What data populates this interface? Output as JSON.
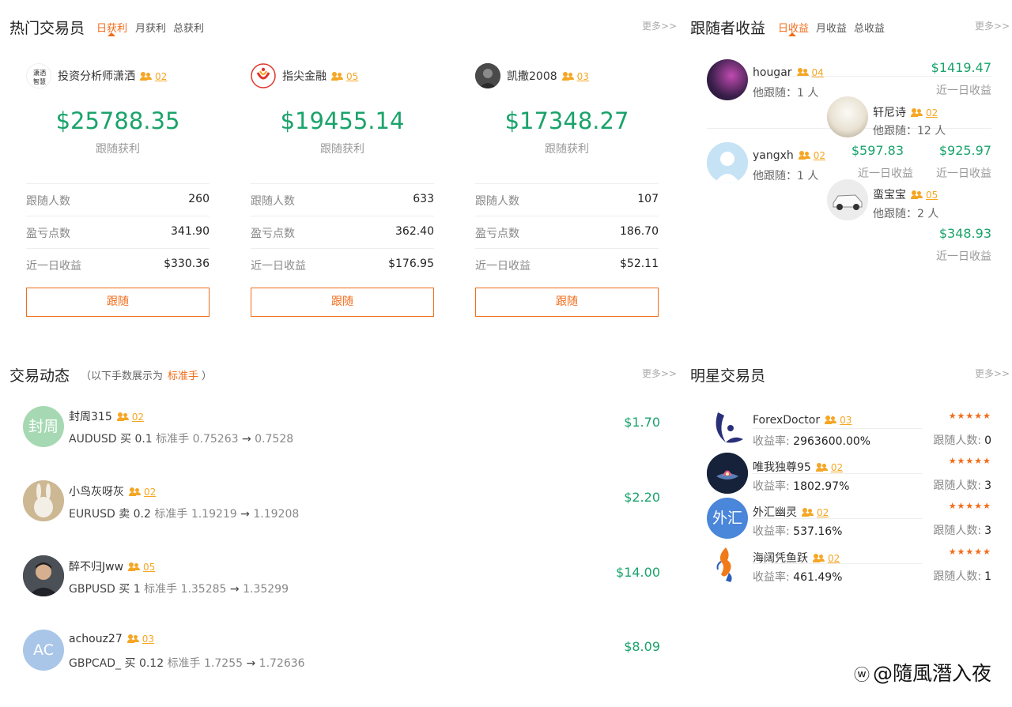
{
  "hot_traders": {
    "title": "热门交易员",
    "tabs": [
      "日获利",
      "月获利",
      "总获利"
    ],
    "more": "更多>>",
    "cards": [
      {
        "name": "投资分析师潇洒",
        "followers_badge": "02",
        "profit": "$25788.35",
        "profit_label": "跟随获利",
        "rows": [
          {
            "k": "跟随人数",
            "v": "260"
          },
          {
            "k": "盈亏点数",
            "v": "341.90"
          },
          {
            "k": "近一日收益",
            "v": "$330.36"
          }
        ],
        "button": "跟随"
      },
      {
        "name": "指尖金融",
        "followers_badge": "05",
        "profit": "$19455.14",
        "profit_label": "跟随获利",
        "rows": [
          {
            "k": "跟随人数",
            "v": "633"
          },
          {
            "k": "盈亏点数",
            "v": "362.40"
          },
          {
            "k": "近一日收益",
            "v": "$176.95"
          }
        ],
        "button": "跟随"
      },
      {
        "name": "凯撒2008",
        "followers_badge": "03",
        "profit": "$17348.27",
        "profit_label": "跟随获利",
        "rows": [
          {
            "k": "跟随人数",
            "v": "107"
          },
          {
            "k": "盈亏点数",
            "v": "186.70"
          },
          {
            "k": "近一日收益",
            "v": "$52.11"
          }
        ],
        "button": "跟随"
      }
    ],
    "logo_text": "潇洒智慧"
  },
  "follower_earnings": {
    "title": "跟随者收益",
    "tabs": [
      "日收益",
      "月收益",
      "总收益"
    ],
    "more": "更多>>",
    "entries": [
      {
        "name": "hougar",
        "badge": "04",
        "sub": "他跟随：1 人",
        "amount": "$1419.47",
        "label": "近一日收益"
      },
      {
        "name": "轩尼诗",
        "badge": "02",
        "sub": "他跟随：12 人",
        "amount": "$925.97",
        "label": "近一日收益"
      },
      {
        "name": "yangxh",
        "badge": "02",
        "sub": "他跟随：1 人",
        "amount": "$597.83",
        "label": "近一日收益"
      },
      {
        "name": "蛮宝宝",
        "badge": "05",
        "sub": "他跟随：2 人",
        "amount": "$348.93",
        "label": "近一日收益"
      }
    ]
  },
  "trade_feed": {
    "title": "交易动态",
    "note_prefix": "（以下手数展示为",
    "note_highlight": "标准手",
    "note_suffix": "）",
    "more": "更多>>",
    "items": [
      {
        "avatar_text": "封周",
        "avatar_color": "#a6d9b3",
        "name": "封周315",
        "badge": "02",
        "pair": "AUDUSD",
        "side": "买",
        "lots": "0.1",
        "unit": "标准手",
        "from": "0.75263",
        "arrow": "→",
        "to": "0.7528",
        "amount": "$1.70"
      },
      {
        "avatar_text": "",
        "avatar_color": "#d9c7a5",
        "name": "小鸟灰呀灰",
        "badge": "02",
        "pair": "EURUSD",
        "side": "卖",
        "lots": "0.2",
        "unit": "标准手",
        "from": "1.19219",
        "arrow": "→",
        "to": "1.19208",
        "amount": "$2.20"
      },
      {
        "avatar_text": "",
        "avatar_color": "#3a3f45",
        "name": "醉不归Jww",
        "badge": "05",
        "pair": "GBPUSD",
        "side": "买",
        "lots": "1",
        "unit": "标准手",
        "from": "1.35285",
        "arrow": "→",
        "to": "1.35299",
        "amount": "$14.00"
      },
      {
        "avatar_text": "AC",
        "avatar_color": "#a9c6e8",
        "name": "achouz27",
        "badge": "03",
        "pair": "GBPCAD_",
        "side": "买",
        "lots": "0.12",
        "unit": "标准手",
        "from": "1.7255",
        "arrow": "→",
        "to": "1.72636",
        "amount": "$8.09"
      }
    ]
  },
  "star_traders": {
    "title": "明星交易员",
    "more": "更多>>",
    "rate_label": "收益率:",
    "followers_label": "跟随人数:",
    "stars": "★★★★★",
    "items": [
      {
        "name": "ForexDoctor",
        "badge": "03",
        "rate": "2963600.00%",
        "followers": "0",
        "avatar_text": "",
        "avatar_color": "#ffffff"
      },
      {
        "name": "唯我独尊95",
        "badge": "02",
        "rate": "1802.97%",
        "followers": "3",
        "avatar_text": "",
        "avatar_color": "#1c2a44"
      },
      {
        "name": "外汇幽灵",
        "badge": "02",
        "rate": "537.16%",
        "followers": "3",
        "avatar_text": "外汇",
        "avatar_color": "#4a86d9"
      },
      {
        "name": "海阔凭鱼跃",
        "badge": "02",
        "rate": "461.49%",
        "followers": "1",
        "avatar_text": "",
        "avatar_color": "#ffffff"
      }
    ]
  },
  "watermark": "@隨風潛入夜",
  "colors": {
    "accent": "#f26c1a",
    "profit_green": "#1aa36b",
    "badge_orange": "#f5a623"
  }
}
